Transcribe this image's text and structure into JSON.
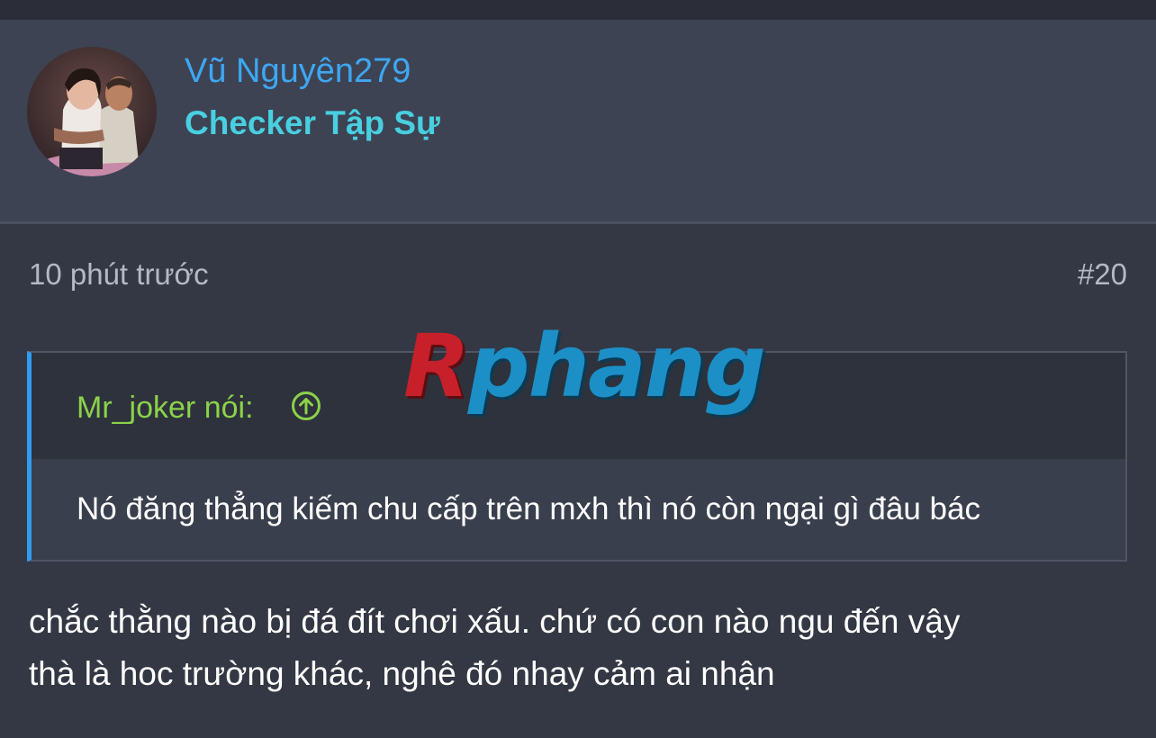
{
  "user": {
    "name": "Vũ Nguyên279",
    "title": "Checker Tập Sự",
    "avatar_icon": "avatar-photo"
  },
  "post": {
    "time": "10 phút trước",
    "number": "#20"
  },
  "watermark": {
    "first": "R",
    "rest": "phang",
    "colors": {
      "first": "#c7202a",
      "rest": "#1c8fc6"
    }
  },
  "quote": {
    "author": "Mr_joker nói:",
    "text": "Nó đăng thẳng kiếm chu cấp trên mxh thì nó còn ngại gì đâu bác",
    "icon": "arrow-up-circle-icon"
  },
  "message": {
    "line1": "chắc thằng nào bị đá đít chơi xấu. chứ có con nào ngu đến vậy",
    "line2": "thà là hoc trường khác, nghê đó nhay cảm ai nhận"
  },
  "colors": {
    "background": "#343844",
    "header": "#3d4353",
    "username": "#3ea7f2",
    "user_title": "#48cfe0",
    "quote_author": "#8bd24a",
    "quote_border": "#2f9cf0"
  }
}
